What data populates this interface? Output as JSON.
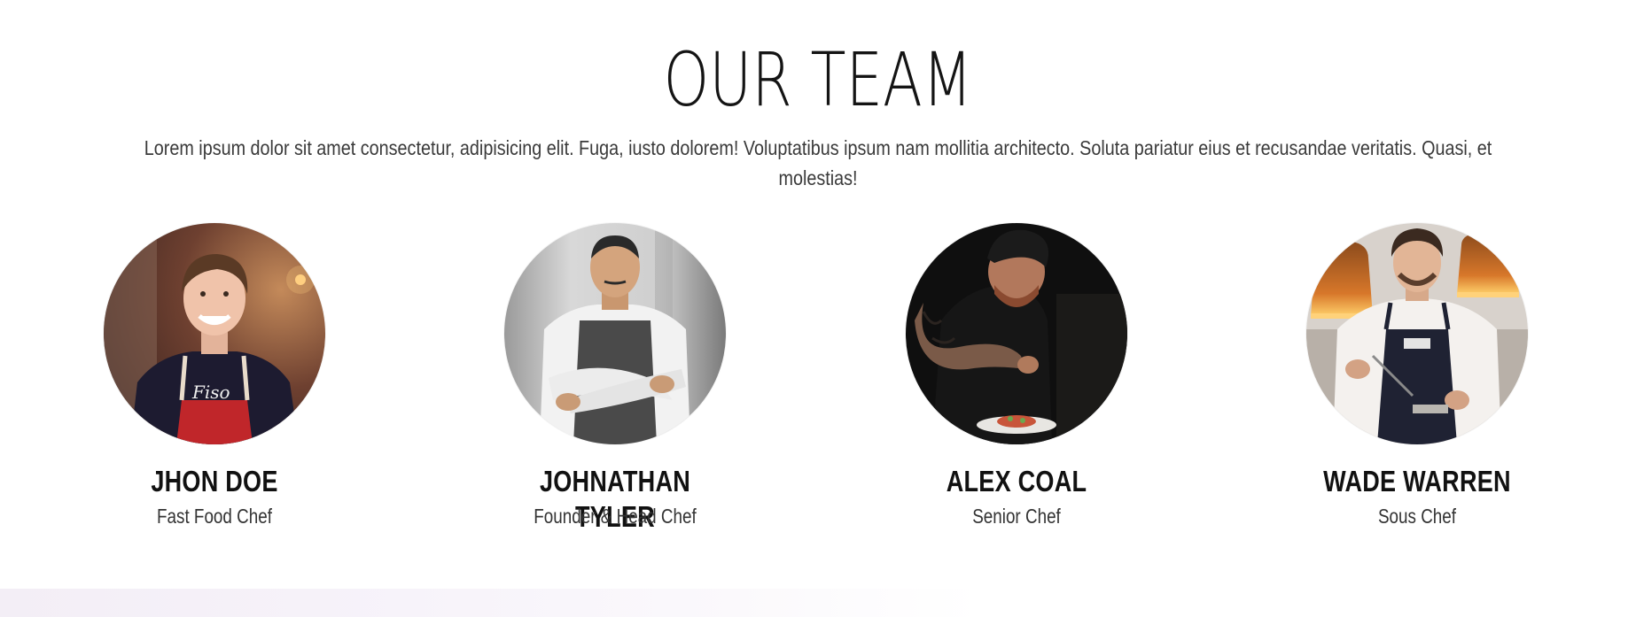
{
  "section": {
    "title": "OUR TEAM",
    "subtitle": "Lorem ipsum dolor sit amet consectetur, adipisicing elit. Fuga, iusto dolorem! Voluptatibus ipsum nam mollitia architecto. Soluta pariatur eius et recusandae veritatis. Quasi, et molestias!"
  },
  "team": [
    {
      "name": "JHON DOE",
      "role": "Fast Food Chef"
    },
    {
      "name": "JOHNATHAN TYLER",
      "role": "Founder & Head Chef"
    },
    {
      "name": "ALEX COAL",
      "role": "Senior Chef"
    },
    {
      "name": "WADE WARREN",
      "role": "Sous Chef"
    }
  ]
}
